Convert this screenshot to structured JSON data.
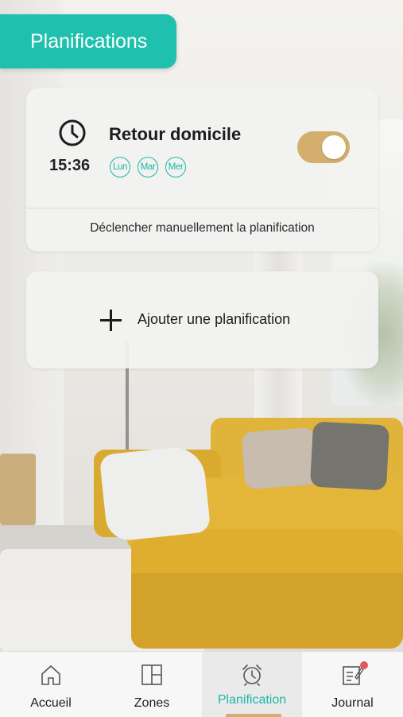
{
  "header": {
    "title": "Planifications"
  },
  "schedule": {
    "time": "15:36",
    "name": "Retour domicile",
    "days": [
      "Lun",
      "Mar",
      "Mer"
    ],
    "enabled": true,
    "manual_trigger_label": "Déclencher manuellement la planification"
  },
  "add": {
    "label": "Ajouter une planification"
  },
  "nav": {
    "items": [
      {
        "label": "Accueil",
        "icon": "home-icon"
      },
      {
        "label": "Zones",
        "icon": "grid-icon"
      },
      {
        "label": "Planification",
        "icon": "alarm-clock-icon",
        "active": true
      },
      {
        "label": "Journal",
        "icon": "journal-edit-icon",
        "notification": true
      }
    ]
  },
  "colors": {
    "accent": "#20c0ae",
    "toggle": "#d3ae6c",
    "notification": "#e05a5a"
  }
}
